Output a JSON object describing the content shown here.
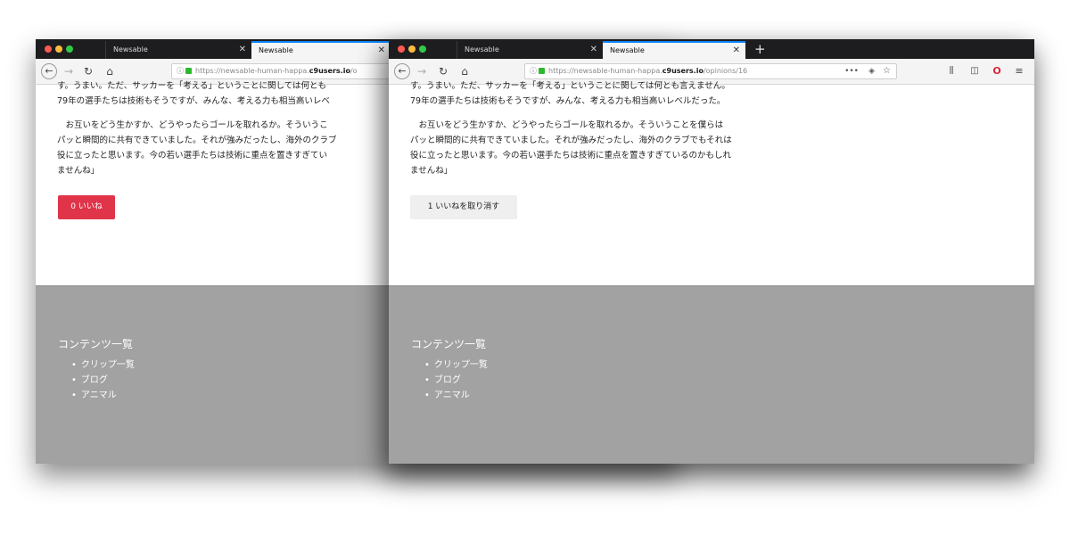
{
  "left_window": {
    "tabs": [
      {
        "title": "Newsable",
        "close": "✕"
      },
      {
        "title": "Newsable",
        "close": "✕"
      }
    ],
    "url": {
      "prefix": "https://newsable-human-happa.",
      "domain": "c9users.io",
      "suffix": "/o"
    },
    "paragraphs": [
      "す。うまい。ただ、サッカーを「考える」ということに関しては何とも",
      "79年の選手たちは技術もそうですが、みんな、考える力も相当高いレベ",
      "　お互いをどう生かすか、どうやったらゴールを取れるか。そういうこ",
      "パッと瞬間的に共有できていました。それが強みだったし、海外のクラブ",
      "役に立ったと思います。今の若い選手たちは技術に重点を置きすぎてい",
      "ませんね」"
    ],
    "like_button": "0 いいね",
    "footer": {
      "title": "コンテンツ一覧",
      "links": [
        "クリップ一覧",
        "ブログ",
        "アニマル"
      ]
    }
  },
  "right_window": {
    "tabs": [
      {
        "title": "Newsable",
        "close": "✕"
      },
      {
        "title": "Newsable",
        "close": "✕"
      }
    ],
    "new_tab": "+",
    "url": {
      "prefix": "https://newsable-human-happa.",
      "domain": "c9users.io",
      "suffix": "/opinions/16"
    },
    "toolbar_icons": [
      "more-icon",
      "pocket-icon",
      "bookmark-star-icon",
      "library-icon",
      "sidebar-icon",
      "opera-icon",
      "menu-icon"
    ],
    "paragraphs": [
      "す。うまい。ただ、サッカーを「考える」ということに関しては何とも言えません。",
      "79年の選手たちは技術もそうですが、みんな、考える力も相当高いレベルだった。",
      "　お互いをどう生かすか、どうやったらゴールを取れるか。そういうことを僕らは",
      "パッと瞬間的に共有できていました。それが強みだったし、海外のクラブでもそれは",
      "役に立ったと思います。今の若い選手たちは技術に重点を置きすぎているのかもしれ",
      "ませんね」"
    ],
    "unlike_button": "1 いいねを取り消す",
    "footer": {
      "title": "コンテンツ一覧",
      "links": [
        "クリップ一覧",
        "ブログ",
        "アニマル"
      ]
    }
  },
  "colors": {
    "like_red": "#e0344a",
    "footer_gray": "#a2a2a2",
    "tab_bar": "#1d1d1f",
    "active_tab_accent": "#0a84ff"
  }
}
